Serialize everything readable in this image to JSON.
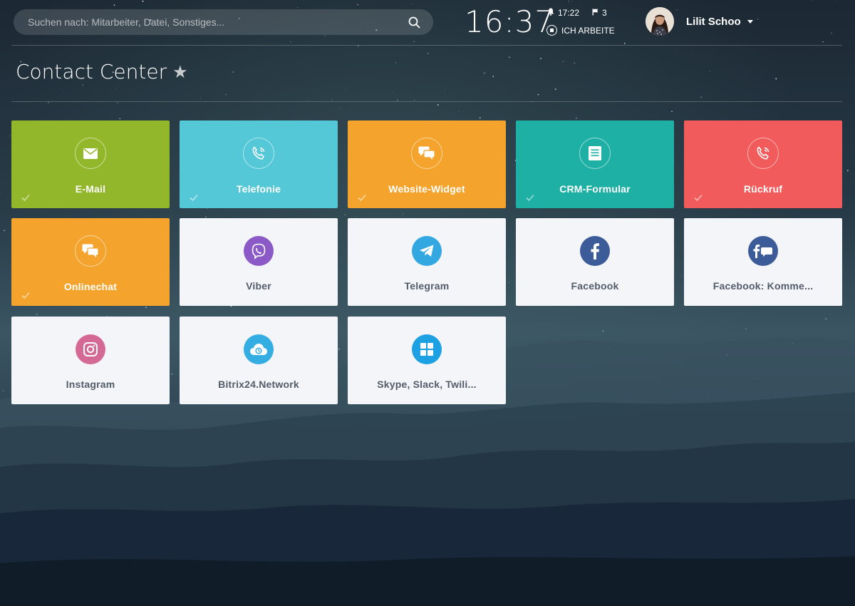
{
  "header": {
    "search_placeholder": "Suchen nach: Mitarbeiter, Datei, Sonstiges...",
    "clock": "16:37",
    "alarm_time": "17:22",
    "flag_count": "3",
    "workday_status": "ICH ARBEITE",
    "user_name": "Lilit Schoo"
  },
  "page": {
    "title": "Contact Center"
  },
  "tiles": [
    {
      "label": "E-Mail",
      "icon": "envelope-icon",
      "color": "#93b72a",
      "active": true
    },
    {
      "label": "Telefonie",
      "icon": "phone-icon",
      "color": "#55c8d8",
      "active": true
    },
    {
      "label": "Website-Widget",
      "icon": "chat-icon",
      "color": "#f4a42c",
      "active": true
    },
    {
      "label": "CRM-Formular",
      "icon": "form-icon",
      "color": "#1eb0a4",
      "active": true
    },
    {
      "label": "Rückruf",
      "icon": "callback-icon",
      "color": "#f25b5c",
      "active": true
    },
    {
      "label": "Onlinechat",
      "icon": "chat-icon",
      "color": "#f4a42c",
      "active": true
    },
    {
      "label": "Viber",
      "icon": "viber-icon",
      "color": "#8c5ac7",
      "active": false
    },
    {
      "label": "Telegram",
      "icon": "telegram-icon",
      "color": "#33a8e0",
      "active": false
    },
    {
      "label": "Facebook",
      "icon": "facebook-icon",
      "color": "#3b5b99",
      "active": false
    },
    {
      "label": "Facebook: Komme...",
      "icon": "facebook-comments-icon",
      "color": "#3b5b99",
      "active": false
    },
    {
      "label": "Instagram",
      "icon": "instagram-icon",
      "color": "#d56996",
      "active": false
    },
    {
      "label": "Bitrix24.Network",
      "icon": "cloud-icon",
      "color": "#34aee2",
      "active": false
    },
    {
      "label": "Skype, Slack, Twili...",
      "icon": "grid-icon",
      "color": "#1da1e2",
      "active": false
    }
  ]
}
